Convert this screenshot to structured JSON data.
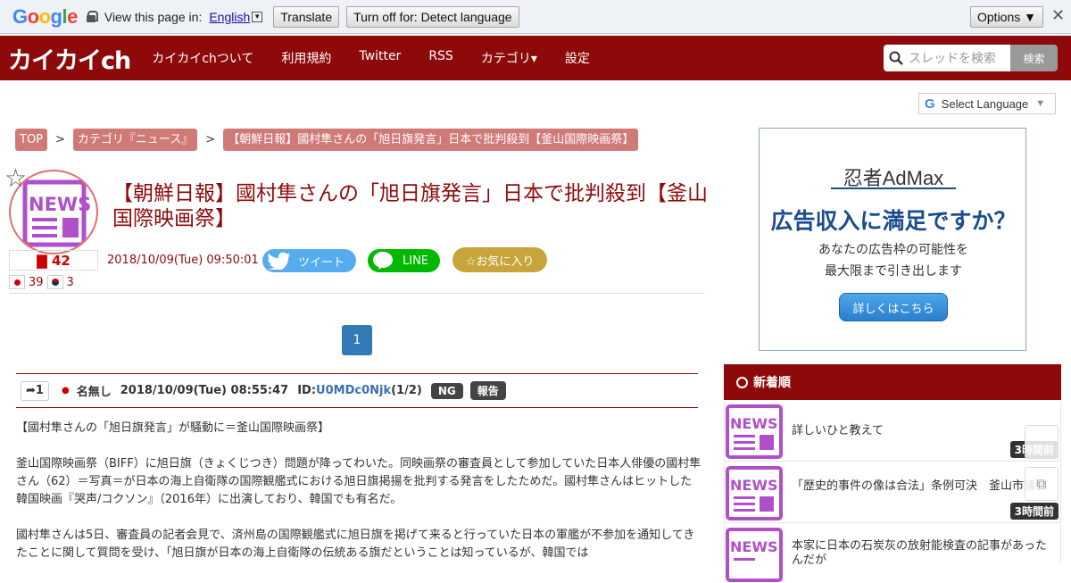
{
  "translate_bar": {
    "prompt": "View this page in:",
    "language": "English",
    "translate_button": "Translate",
    "turn_off_button": "Turn off for: Detect language",
    "options_button": "Options ▼"
  },
  "header": {
    "logo": "カイカイch",
    "nav": [
      "カイカイchついて",
      "利用規約",
      "Twitter",
      "RSS",
      "カテゴリ▾",
      "設定"
    ],
    "search_placeholder": "スレッドを検索",
    "search_button": "検索"
  },
  "select_language": "Select Language",
  "breadcrumb": [
    "TOP",
    "カテゴリ『ニュース』",
    "【朝鮮日報】國村隼さんの「旭日旗発言」日本で批判殺到【釜山国際映画祭】"
  ],
  "breadcrumb_sep": ">",
  "thread": {
    "title": "【朝鮮日報】國村隼さんの「旭日旗発言」日本で批判殺到【釜山国際映画祭】",
    "res_count": "42",
    "date": "2018/10/09(Tue) 09:50:01",
    "tweet_label": "ツイート",
    "line_label": "LINE",
    "fav_label": "☆お気に入り",
    "jp_count": "39",
    "kr_count": "3",
    "page": "1"
  },
  "post": {
    "num": "1",
    "name": "名無し",
    "date": "2018/10/09(Tue) 08:55:47",
    "id_label": "ID:",
    "id": "U0MDc0Njk",
    "id_count": "(1/2)",
    "ng": "NG",
    "report": "報告",
    "paragraphs": [
      "【國村隼さんの「旭日旗発言」が騒動に＝釜山国際映画祭】",
      "釜山国際映画祭（BIFF）に旭日旗（きょくじつき）問題が降ってわいた。同映画祭の審査員として参加していた日本人俳優の國村隼さん（62）＝写真＝が日本の海上自衛隊の国際観艦式における旭日旗掲揚を批判する発言をしたためだ。國村隼さんはヒットした韓国映画『哭声/コクソン』（2016年）に出演しており、韓国でも有名だ。",
      "國村隼さんは5日、審査員の記者会見で、済州島の国際観艦式に旭日旗を掲げて来ると行っていた日本の軍艦が不参加を通知してきたことに関して質問を受け、「旭日旗が日本の海上自衛隊の伝統ある旗だということは知っているが、韓国では"
    ]
  },
  "ad": {
    "brand": "忍者AdMax",
    "headline": "広告収入に満足ですか？",
    "line1": "あなたの広告枠の可能性を",
    "line2": "最大限まで引き出します",
    "button": "詳しくはこちら"
  },
  "sidebar": {
    "heading": "新着順",
    "items": [
      {
        "text": "詳しいひと教えて",
        "time": "3時間前"
      },
      {
        "text": "「歴史的事件の像は合法」条例可決　釜山市議会",
        "time": "3時間前"
      },
      {
        "text": "本家に日本の石炭灰の放射能検査の記事があったんだが",
        "time": ""
      }
    ]
  },
  "colors": {
    "brand": "#8e0a0a",
    "breadcrumb": "#d07a78",
    "twitter": "#55acee",
    "line": "#00b900",
    "fav": "#c8a53a"
  }
}
